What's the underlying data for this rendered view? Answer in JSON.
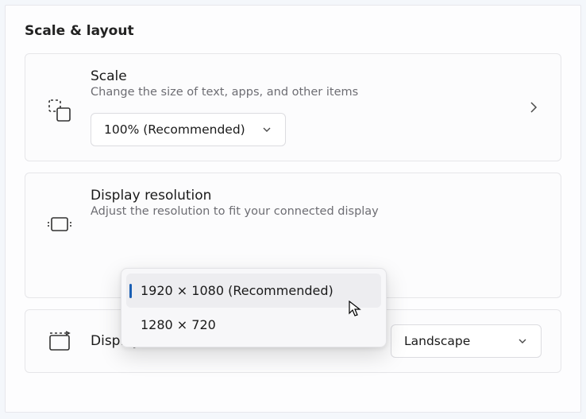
{
  "section_title": "Scale & layout",
  "scale": {
    "title": "Scale",
    "desc": "Change the size of text, apps, and other items",
    "selected": "100% (Recommended)"
  },
  "resolution": {
    "title": "Display resolution",
    "desc": "Adjust the resolution to fit your connected display",
    "options": [
      "1920 × 1080 (Recommended)",
      "1280 × 720"
    ]
  },
  "orientation": {
    "title": "Display orientation",
    "selected": "Landscape"
  }
}
